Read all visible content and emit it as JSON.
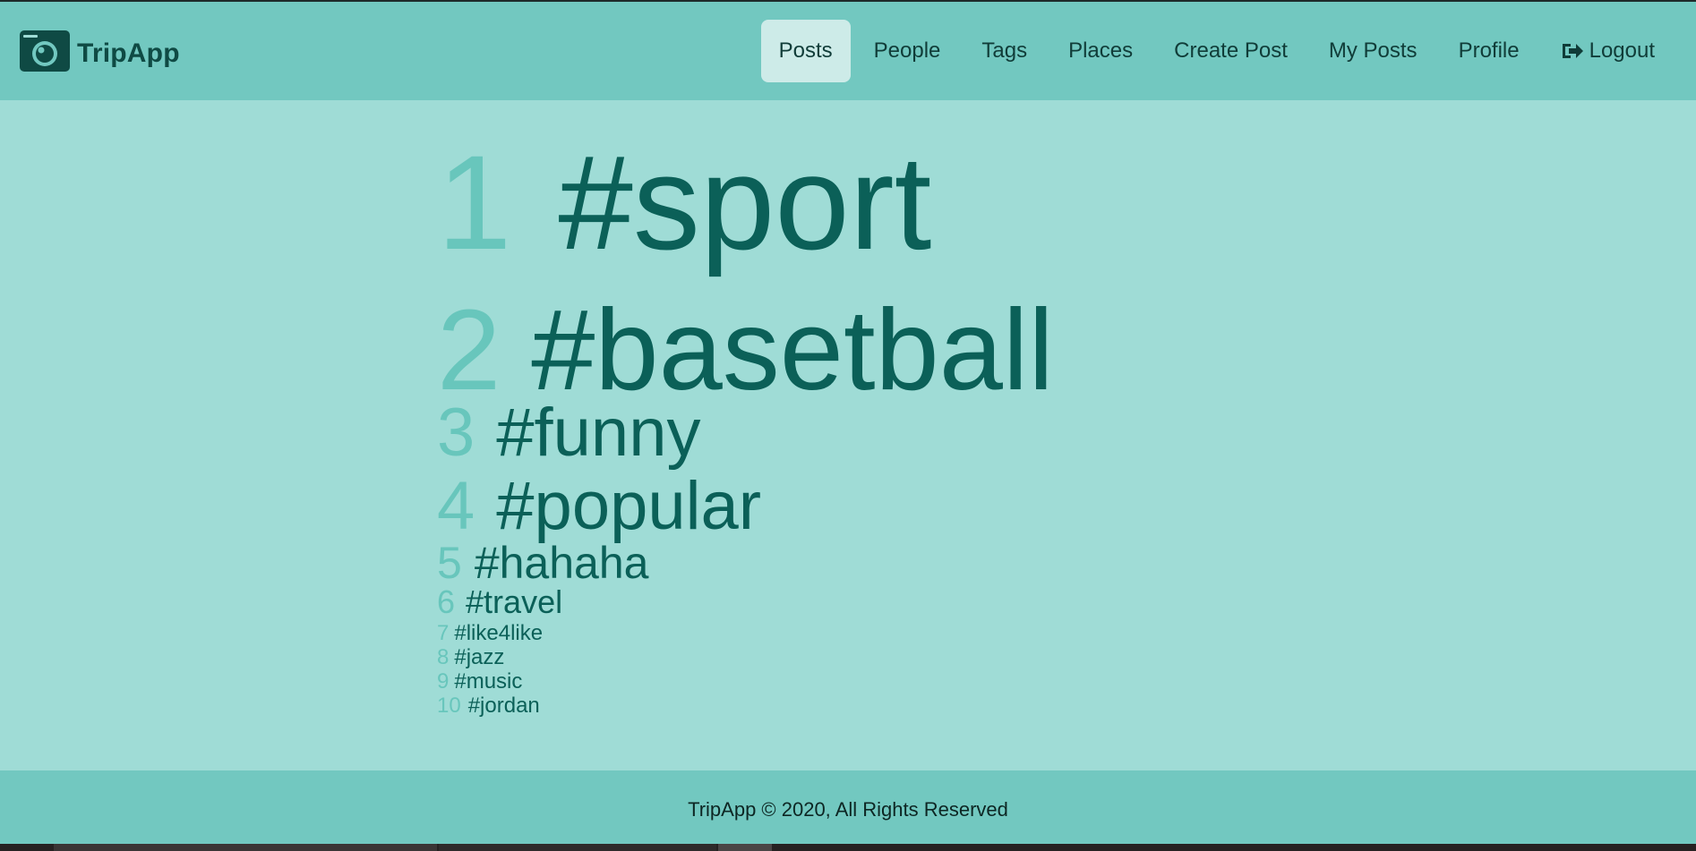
{
  "app": {
    "name": "TripApp",
    "logo_icon": "camera-icon"
  },
  "nav": {
    "items": [
      {
        "label": "Posts",
        "active": true
      },
      {
        "label": "People",
        "active": false
      },
      {
        "label": "Tags",
        "active": false
      },
      {
        "label": "Places",
        "active": false
      },
      {
        "label": "Create Post",
        "active": false
      },
      {
        "label": "My Posts",
        "active": false
      },
      {
        "label": "Profile",
        "active": false
      }
    ],
    "logout": {
      "label": "Logout",
      "icon": "sign-out-icon"
    }
  },
  "tags": [
    {
      "rank": "1",
      "name": "#sport"
    },
    {
      "rank": "2",
      "name": "#basetball"
    },
    {
      "rank": "3",
      "name": "#funny"
    },
    {
      "rank": "4",
      "name": "#popular"
    },
    {
      "rank": "5",
      "name": "#hahaha"
    },
    {
      "rank": "6",
      "name": "#travel"
    },
    {
      "rank": "7",
      "name": "#like4like"
    },
    {
      "rank": "8",
      "name": "#jazz"
    },
    {
      "rank": "9",
      "name": "#music"
    },
    {
      "rank": "10",
      "name": "#jordan"
    }
  ],
  "footer": {
    "text": "TripApp © 2020, All Rights Reserved"
  },
  "colors": {
    "navbar": "#72c8c0",
    "page_background": "#9fdcd6",
    "active_nav": "#cdebe8",
    "rank_number": "#68c6bc",
    "tag_text": "#0b6058",
    "brand_text": "#0f4a44"
  }
}
